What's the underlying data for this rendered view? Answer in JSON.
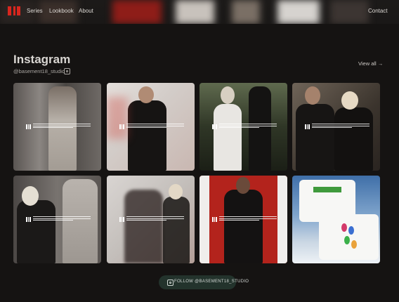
{
  "header": {
    "nav": [
      "Series",
      "Lookbook",
      "About"
    ],
    "contact_label": "Contact"
  },
  "instagram": {
    "title": "Instagram",
    "handle": "@basement18_studio",
    "view_all_label": "View all →",
    "follow_label": "FOLLOW @BASEMENT18_STUDIO",
    "posts": [
      {
        "alt": "model in light vest in elevator"
      },
      {
        "alt": "model in black tee"
      },
      {
        "alt": "model in white graphic tee at night"
      },
      {
        "alt": "two models in black"
      },
      {
        "alt": "model with blonde hair in elevator"
      },
      {
        "alt": "two models blurred"
      },
      {
        "alt": "bearded model on red background"
      },
      {
        "alt": "two tees over clouds"
      }
    ]
  },
  "colors": {
    "background": "#151312",
    "accent": "#d8261e",
    "follow_button": "#23332c"
  }
}
